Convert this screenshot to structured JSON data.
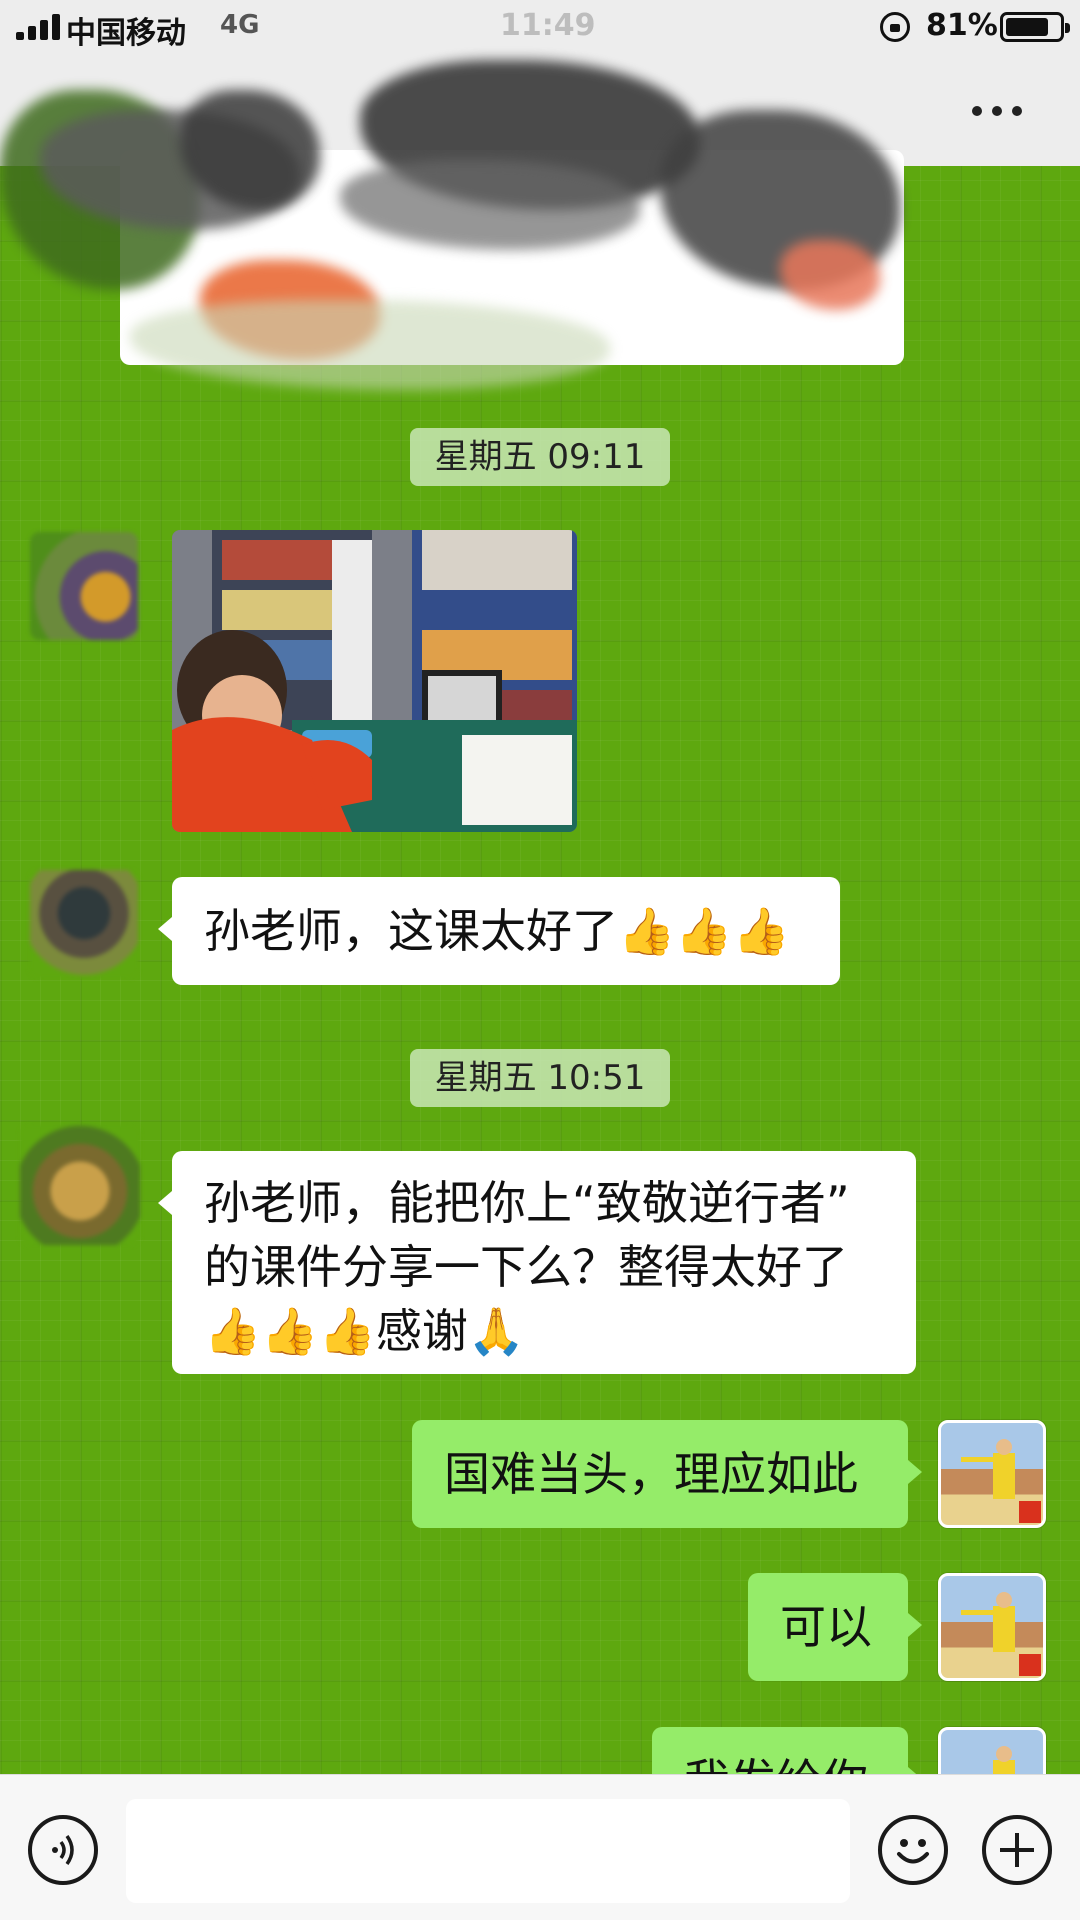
{
  "status_bar": {
    "carrier": "中国移动",
    "network": "4G",
    "time": "11:49",
    "battery_percent_label": "81%",
    "battery_level": 0.81
  },
  "nav_bar": {
    "more_icon": "more-icon"
  },
  "messages": [
    {
      "kind": "time",
      "text": "星期五 09:11"
    },
    {
      "kind": "image",
      "from": "other",
      "description_icon": "photo-icon"
    },
    {
      "kind": "text",
      "from": "other",
      "text": "孙老师，这课太好了👍👍👍"
    },
    {
      "kind": "time",
      "text": "星期五 10:51"
    },
    {
      "kind": "text",
      "from": "other",
      "lines": [
        "孙老师，能把你上“致敬逆行者”",
        "的课件分享一下么？整得太好了",
        "👍👍👍感谢🙏"
      ]
    },
    {
      "kind": "text",
      "from": "self",
      "text": "国难当头，理应如此"
    },
    {
      "kind": "text",
      "from": "self",
      "text": "可以"
    },
    {
      "kind": "text",
      "from": "self",
      "text": "我发给你",
      "partially_visible": true
    }
  ],
  "input_bar": {
    "voice_icon": "voice-icon",
    "emoji_icon": "emoji-icon",
    "plus_icon": "plus-icon",
    "placeholder": ""
  },
  "colors": {
    "wallpaper": "#5ea80f",
    "incoming_bubble": "#ffffff",
    "outgoing_bubble": "#95ec69",
    "time_badge": "#c8e6b4",
    "bar_background": "#ededed"
  }
}
